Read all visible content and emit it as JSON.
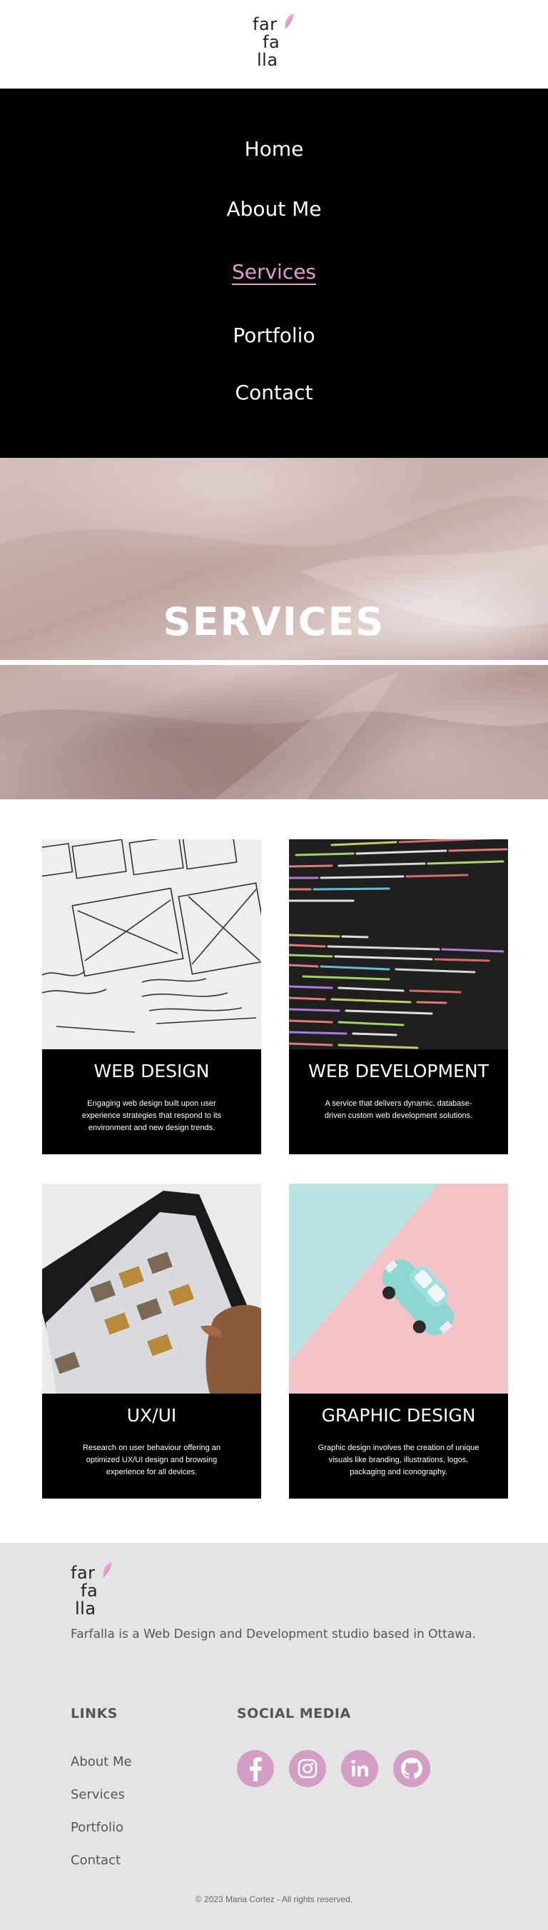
{
  "brand": {
    "logo_line1": "far",
    "logo_line2": "fa",
    "logo_line3": "lla",
    "accent": "#e59bd0"
  },
  "nav": {
    "items": [
      {
        "label": "Home",
        "active": false
      },
      {
        "label": "About Me",
        "active": false
      },
      {
        "label": "Services",
        "active": true
      },
      {
        "label": "Portfolio",
        "active": false
      },
      {
        "label": "Contact",
        "active": false
      }
    ]
  },
  "hero": {
    "title": "SERVICES"
  },
  "services": [
    {
      "title": "WEB DESIGN",
      "description": "Engaging web design built upon user experience strategies that respond to its environment and new design trends.",
      "image_icon": "wireframe-sketch-image"
    },
    {
      "title": "WEB DEVELOPMENT",
      "description": "A service that delivers dynamic, database-driven custom web development solutions.",
      "image_icon": "code-editor-image"
    },
    {
      "title": "UX/UI",
      "description": "Research on user behaviour offering an optimized UX/UI design and browsing experience for all devices.",
      "image_icon": "tablet-image"
    },
    {
      "title": "GRAPHIC DESIGN",
      "description": "Graphic design involves the creation of unique visuals like branding, illustrations, logos, packaging and iconography.",
      "image_icon": "toy-car-image"
    }
  ],
  "footer": {
    "about": "Farfalla is a Web Design and Development studio based in Ottawa.",
    "links_heading": "LINKS",
    "links": [
      "About Me",
      "Services",
      "Portfolio",
      "Contact"
    ],
    "social_heading": "SOCIAL MEDIA",
    "social": [
      "facebook-icon",
      "instagram-icon",
      "linkedin-icon",
      "github-icon"
    ],
    "social_color": "#d49ec4",
    "copyright": "© 2023 Maria Cortez - All rights reserved."
  }
}
